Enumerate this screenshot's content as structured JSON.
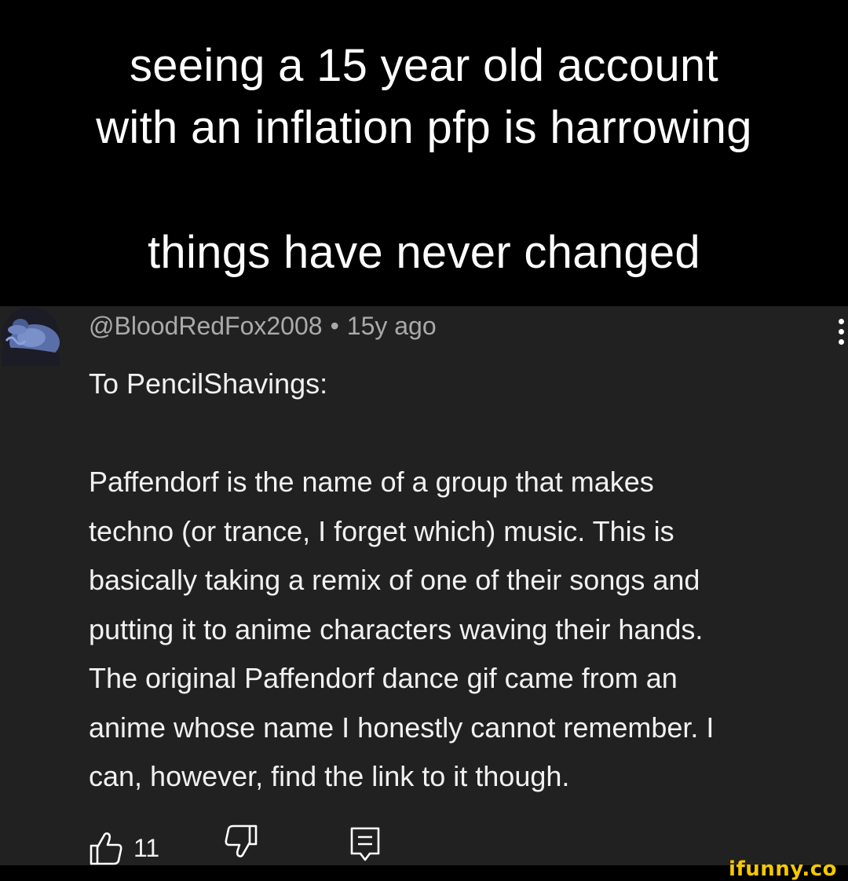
{
  "caption": {
    "line1": "seeing a 15 year old account",
    "line2": "with an inflation pfp is harrowing",
    "line3": "things have never changed"
  },
  "comment": {
    "username": "@BloodRedFox2008",
    "separator": "•",
    "time": "15y ago",
    "lines": [
      "To PencilShavings:",
      "",
      "Paffendorf is the name of a group that makes",
      "techno (or trance, I forget which) music. This is",
      "basically taking a remix of one of their songs and",
      "putting it to anime characters waving their hands.",
      "The original Paffendorf dance gif came from an",
      "anime whose name I honestly cannot remember. I",
      "can, however, find the link to it though."
    ],
    "like_count": "11"
  },
  "icons": {
    "avatar": "avatar-blob-image",
    "more": "more-vertical-icon",
    "like": "thumbs-up-icon",
    "dislike": "thumbs-down-icon",
    "reply": "reply-icon"
  },
  "watermark": "ifunny.co",
  "colors": {
    "caption_bg": "#000000",
    "panel_bg": "#212121",
    "meta_text": "#aaaaaa",
    "body_text": "#f1f1f1",
    "watermark": "#f5c800"
  }
}
